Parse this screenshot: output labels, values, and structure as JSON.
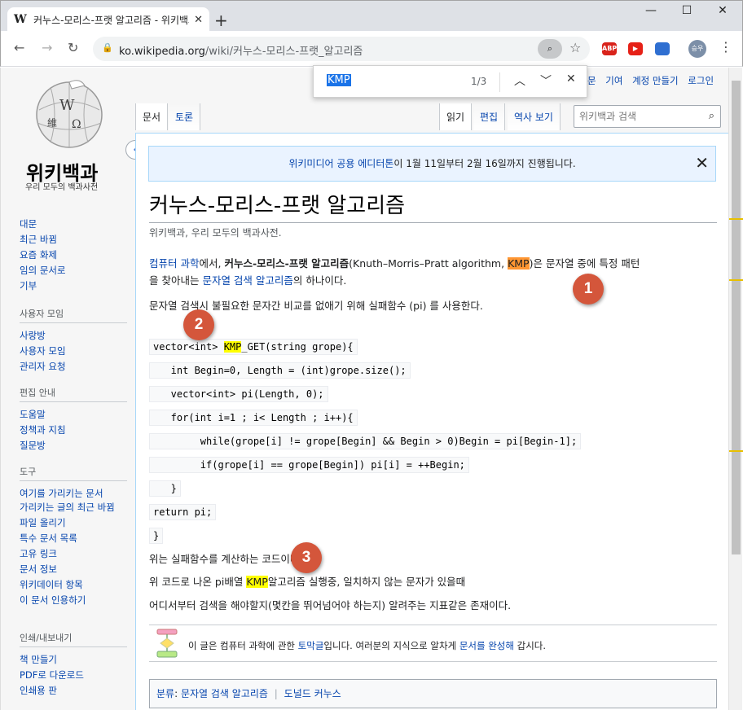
{
  "browser": {
    "tab_title": "커누스-모리스-프랫 알고리즘 - 위키백과",
    "tab_favicon": "W",
    "new_tab_glyph": "+",
    "url_domain": "ko.wikipedia.org",
    "url_path": "/wiki/커누스-모리스-프랫_알고리즘",
    "profile_label": "승우",
    "extensions": [
      "ABP",
      "▶",
      ""
    ],
    "extension_colors": [
      "#d9231b",
      "#e62117",
      "#2f6fd1"
    ]
  },
  "findbar": {
    "query": "KMP",
    "count": "1/3"
  },
  "wiki": {
    "logo_title": "위키백과",
    "logo_subtitle": "우리 모두의 백과사전",
    "personal": [
      "문",
      "기여",
      "계정 만들기",
      "로그인"
    ],
    "tabs_left": [
      "문서",
      "토론"
    ],
    "tabs_right": [
      "읽기",
      "편집",
      "역사 보기"
    ],
    "search_placeholder": "위키백과 검색",
    "sidebar": {
      "main": [
        "대문",
        "최근 바뀜",
        "요즘 화제",
        "임의 문서로",
        "기부"
      ],
      "community_title": "사용자 모임",
      "community": [
        "사랑방",
        "사용자 모임",
        "관리자 요청"
      ],
      "help_title": "편집 안내",
      "help": [
        "도움말",
        "정책과 지침",
        "질문방"
      ],
      "tools_title": "도구",
      "tools": [
        "여기를 가리키는 문서",
        "가리키는 글의 최근 바뀜",
        "파일 올리기",
        "특수 문서 목록",
        "고유 링크",
        "문서 정보",
        "위키데이터 항목",
        "이 문서 인용하기"
      ],
      "print_title": "인쇄/내보내기",
      "print": [
        "책 만들기",
        "PDF로 다운로드",
        "인쇄용 판"
      ]
    },
    "sitenotice": {
      "link": "위키미디어 공용 에디터톤",
      "text": "이 1월 11일부터 2월 16일까지 진행됩니다."
    },
    "title": "커누스-모리스-프랫 알고리즘",
    "subtitle": "위키백과, 우리 모두의 백과사전.",
    "intro": {
      "link1": "컴퓨터 과학",
      "t1": "에서, ",
      "bold": "커누스-모리스-프랫 알고리즘",
      "t2": "(Knuth–Morris–Pratt algorithm, ",
      "kmp": "KMP",
      "t3": ")은 문자열 중에 특정 패턴",
      "t4": "을 찾아내는 ",
      "link2": "문자열 검색 알고리즘",
      "t5": "의 하나이다."
    },
    "para2": "문자열 검색시 불필요한 문자간 비교를 없애기 위해 실패함수 (pi) 를 사용한다.",
    "code": {
      "l1_pre": "vector<int> ",
      "l1_kmp": "KMP",
      "l1_post": "_GET(string grope){",
      "lines": [
        "   int Begin=0, Length = (int)grope.size();",
        "   vector<int> pi(Length, 0);",
        "   for(int i=1 ; i< Length ; i++){",
        "        while(grope[i] != grope[Begin] && Begin > 0)Begin = pi[Begin-1];",
        "        if(grope[i] == grope[Begin]) pi[i] = ++Begin;",
        "   }",
        "return pi;",
        "}"
      ]
    },
    "after1": "위는 실패함수를 계산하는 코드이다.",
    "after2_pre": "위 코드로 나온 pi배열 ",
    "after2_kmp": "KMP",
    "after2_post": "알고리즘 실행중, 일치하지 않는 문자가 있을때",
    "after3": "어디서부터 검색을 해야할지(몇칸을 뛰어넘어야 하는지) 알려주는 지표같은 존재이다.",
    "stub": {
      "t1": "이 글은 컴퓨터 과학에 관한 ",
      "link1": "토막글",
      "t2": "입니다. 여러분의 지식으로 알차게 ",
      "link2": "문서를 완성해",
      "t3": " 갑시다."
    },
    "categories": {
      "label": "분류",
      "items": [
        "문자열 검색 알고리즘",
        "도널드 커누스"
      ]
    }
  },
  "annotations": [
    "1",
    "2",
    "3"
  ],
  "colors": {
    "find_current": "#ff9632",
    "find_match": "#ffff00",
    "link": "#0645ad",
    "badge": "#d4563b"
  }
}
